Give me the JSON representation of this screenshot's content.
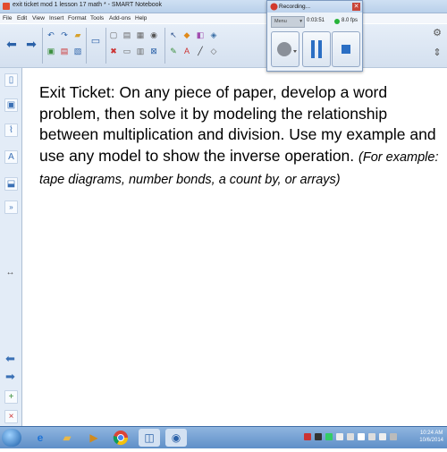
{
  "window": {
    "title": "exit ticket mod 1 lesson 17 math * - SMART Notebook"
  },
  "menu": [
    "File",
    "Edit",
    "View",
    "Insert",
    "Format",
    "Tools",
    "Add-ons",
    "Help"
  ],
  "recorder": {
    "title": "Recording...",
    "menu_label": "Menu",
    "elapsed": "0:03:51",
    "fps": "8.0 fps"
  },
  "page": {
    "exit_ticket_text": "Exit Ticket: On any piece of paper, develop a word problem, then solve it by modeling the relationship between multiplication and division. Use my example and use any model to show the inverse operation.",
    "example_text": "(For example: tape diagrams, number bonds, a count by, or arrays)"
  },
  "clock": {
    "time": "10:24 AM",
    "date": "10/6/2014"
  },
  "colors": {
    "accent": "#2b61a8",
    "record_green": "#27b33a"
  }
}
